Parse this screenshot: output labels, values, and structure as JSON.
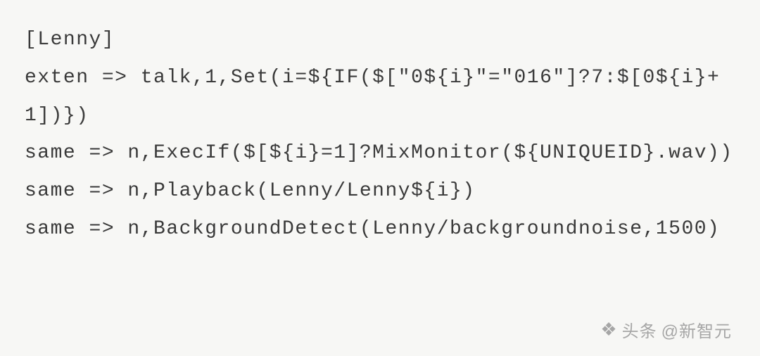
{
  "code": {
    "lines": [
      "[Lenny]",
      "exten => talk,1,Set(i=${IF($[\"0${i}\"=\"016\"]?7:$[0${i}+1])})",
      "same => n,ExecIf($[${i}=1]?MixMonitor(${UNIQUEID}.wav))",
      "same => n,Playback(Lenny/Lenny${i})",
      "same => n,BackgroundDetect(Lenny/backgroundnoise,1500)"
    ]
  },
  "watermark": {
    "prefix": "头条",
    "text": "@新智元"
  }
}
